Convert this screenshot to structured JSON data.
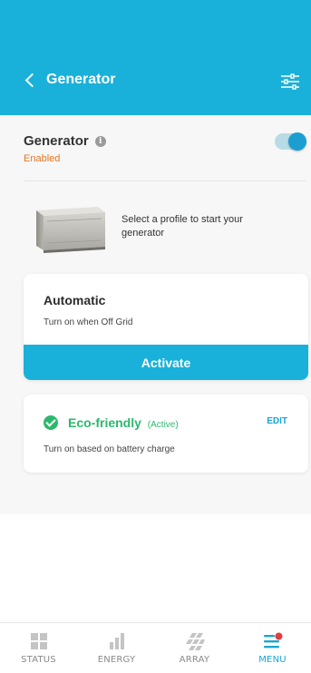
{
  "header": {
    "title": "Generator",
    "background_color": "#19b1d9"
  },
  "generator": {
    "title": "Generator",
    "status": "Enabled",
    "toggle_on": true,
    "profile_hint": "Select a profile to start your generator"
  },
  "profiles": {
    "automatic": {
      "title": "Automatic",
      "description": "Turn on when Off Grid",
      "button_label": "Activate"
    },
    "eco": {
      "title": "Eco-friendly",
      "status": "(Active)",
      "edit_label": "EDIT",
      "description": "Turn on based on battery charge",
      "accent_color": "#2cb86c"
    }
  },
  "tabbar": {
    "items": [
      {
        "label": "STATUS",
        "icon": "grid-icon",
        "active": false
      },
      {
        "label": "ENERGY",
        "icon": "bar-chart-icon",
        "active": false
      },
      {
        "label": "ARRAY",
        "icon": "solar-panel-icon",
        "active": false
      },
      {
        "label": "MENU",
        "icon": "menu-icon",
        "active": true
      }
    ]
  }
}
